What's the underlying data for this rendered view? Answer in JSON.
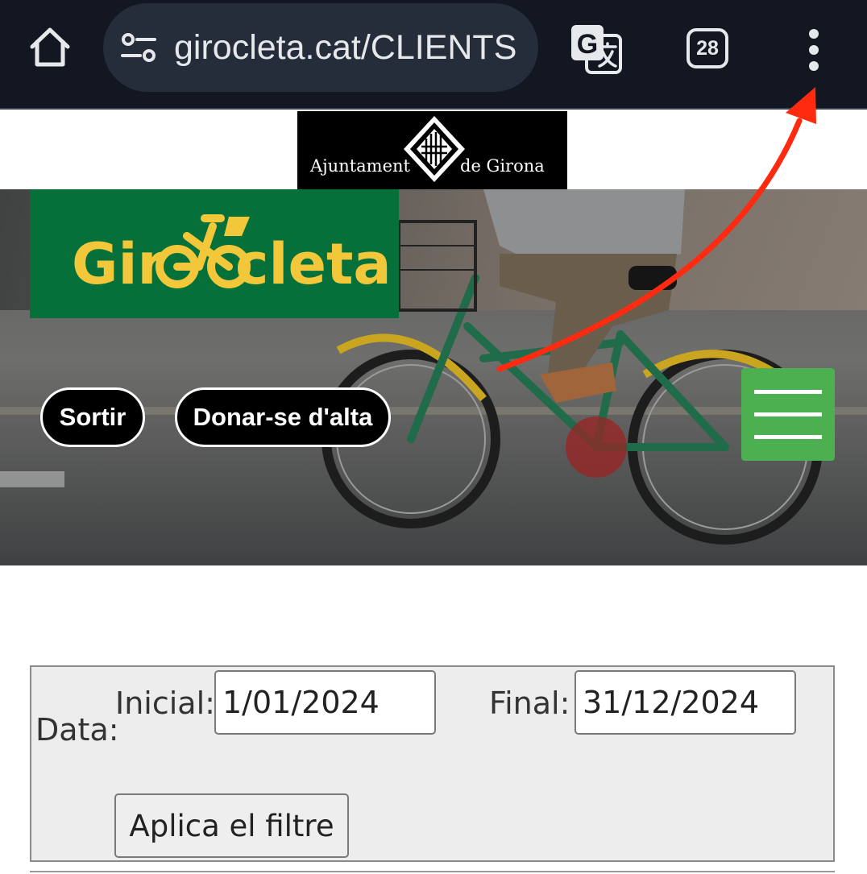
{
  "browser": {
    "url": "girocleta.cat/CLIENTS",
    "tab_count": "28",
    "icons": {
      "home": "home-icon",
      "site_settings": "tune-icon",
      "translate": "translate-icon",
      "tabs": "tab-switcher-icon",
      "menu": "more-vert-icon"
    }
  },
  "header": {
    "ajuntament_logo": {
      "text_left": "Ajuntament",
      "text_right": "de Girona"
    },
    "girocleta_logo": {
      "part1": "Gir",
      "part2": "cleta",
      "bg_color": "#06703a",
      "text_color": "#f2c83a"
    }
  },
  "nav": {
    "sortir_label": "Sortir",
    "alta_label": "Donar-se d'alta",
    "menu_icon": "hamburger-menu-icon",
    "menu_color": "#4caf50"
  },
  "annotation": {
    "arrow_color": "#ff2a10",
    "arrow_icon": "red-arrow-annotation"
  },
  "filter": {
    "date_label": "Data:",
    "start_label": "Inicial:",
    "start_value": "1/01/2024",
    "end_label": "Final:",
    "end_value": "31/12/2024",
    "apply_label": "Aplica el filtre"
  }
}
